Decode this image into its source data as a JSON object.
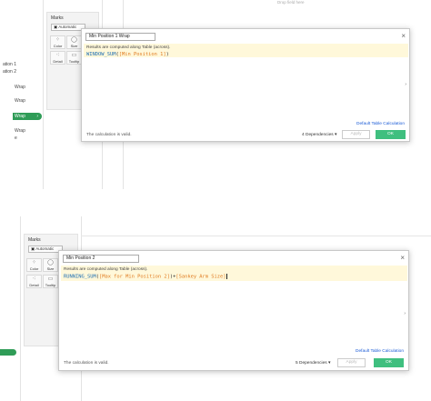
{
  "top": {
    "header_text": "Drop field here",
    "sidebar_items": [
      "ation 1",
      "ation 2",
      "Wrap",
      "Wrap",
      "Wrap",
      "Wrap",
      "e"
    ],
    "marks": {
      "title": "Marks",
      "type": "Automatic",
      "cells": [
        {
          "icon": "color-icon",
          "glyph": "⁘",
          "label": "Color"
        },
        {
          "icon": "size-icon",
          "glyph": "◯",
          "label": "Size"
        },
        {
          "icon": "detail-icon",
          "glyph": "⁖",
          "label": "Detail"
        },
        {
          "icon": "tooltip-icon",
          "glyph": "▭",
          "label": "Tooltip"
        }
      ]
    },
    "dialog": {
      "name": "Min Position 1 Wrap",
      "note": "Results are computed along Table (across).",
      "code_fn": "WINDOW_SUM",
      "code_field": "[Min Position 1]",
      "default_table_calc": "Default Table Calculation",
      "status": "The calculation is valid.",
      "dependencies": "4 Dependencies ▾",
      "apply": "Apply",
      "ok": "OK"
    }
  },
  "bottom": {
    "marks": {
      "title": "Marks",
      "type": "Automatic",
      "cells": [
        {
          "icon": "color-icon",
          "glyph": "⁘",
          "label": "Color"
        },
        {
          "icon": "size-icon",
          "glyph": "◯",
          "label": "Size"
        },
        {
          "icon": "detail-icon",
          "glyph": "⁖",
          "label": "Detail"
        },
        {
          "icon": "tooltip-icon",
          "glyph": "▭",
          "label": "Tooltip"
        }
      ]
    },
    "dialog": {
      "name": "Min Position 2",
      "note": "Results are computed along Table (across).",
      "code_fn": "RUNNING_SUM",
      "code_field1": "[Max for Min Position 2]",
      "code_op": "+",
      "code_field2": "[Sankey Arm Size]",
      "default_table_calc": "Default Table Calculation",
      "status": "The calculation is valid.",
      "dependencies": "5 Dependencies ▾",
      "apply": "Apply",
      "ok": "OK"
    }
  },
  "colors": {
    "ok_green": "#3fbf7f",
    "selected_green": "#2f9c57",
    "function_blue": "#1f6fb2",
    "field_orange": "#e07b20",
    "link_blue": "#1a5bd6"
  }
}
